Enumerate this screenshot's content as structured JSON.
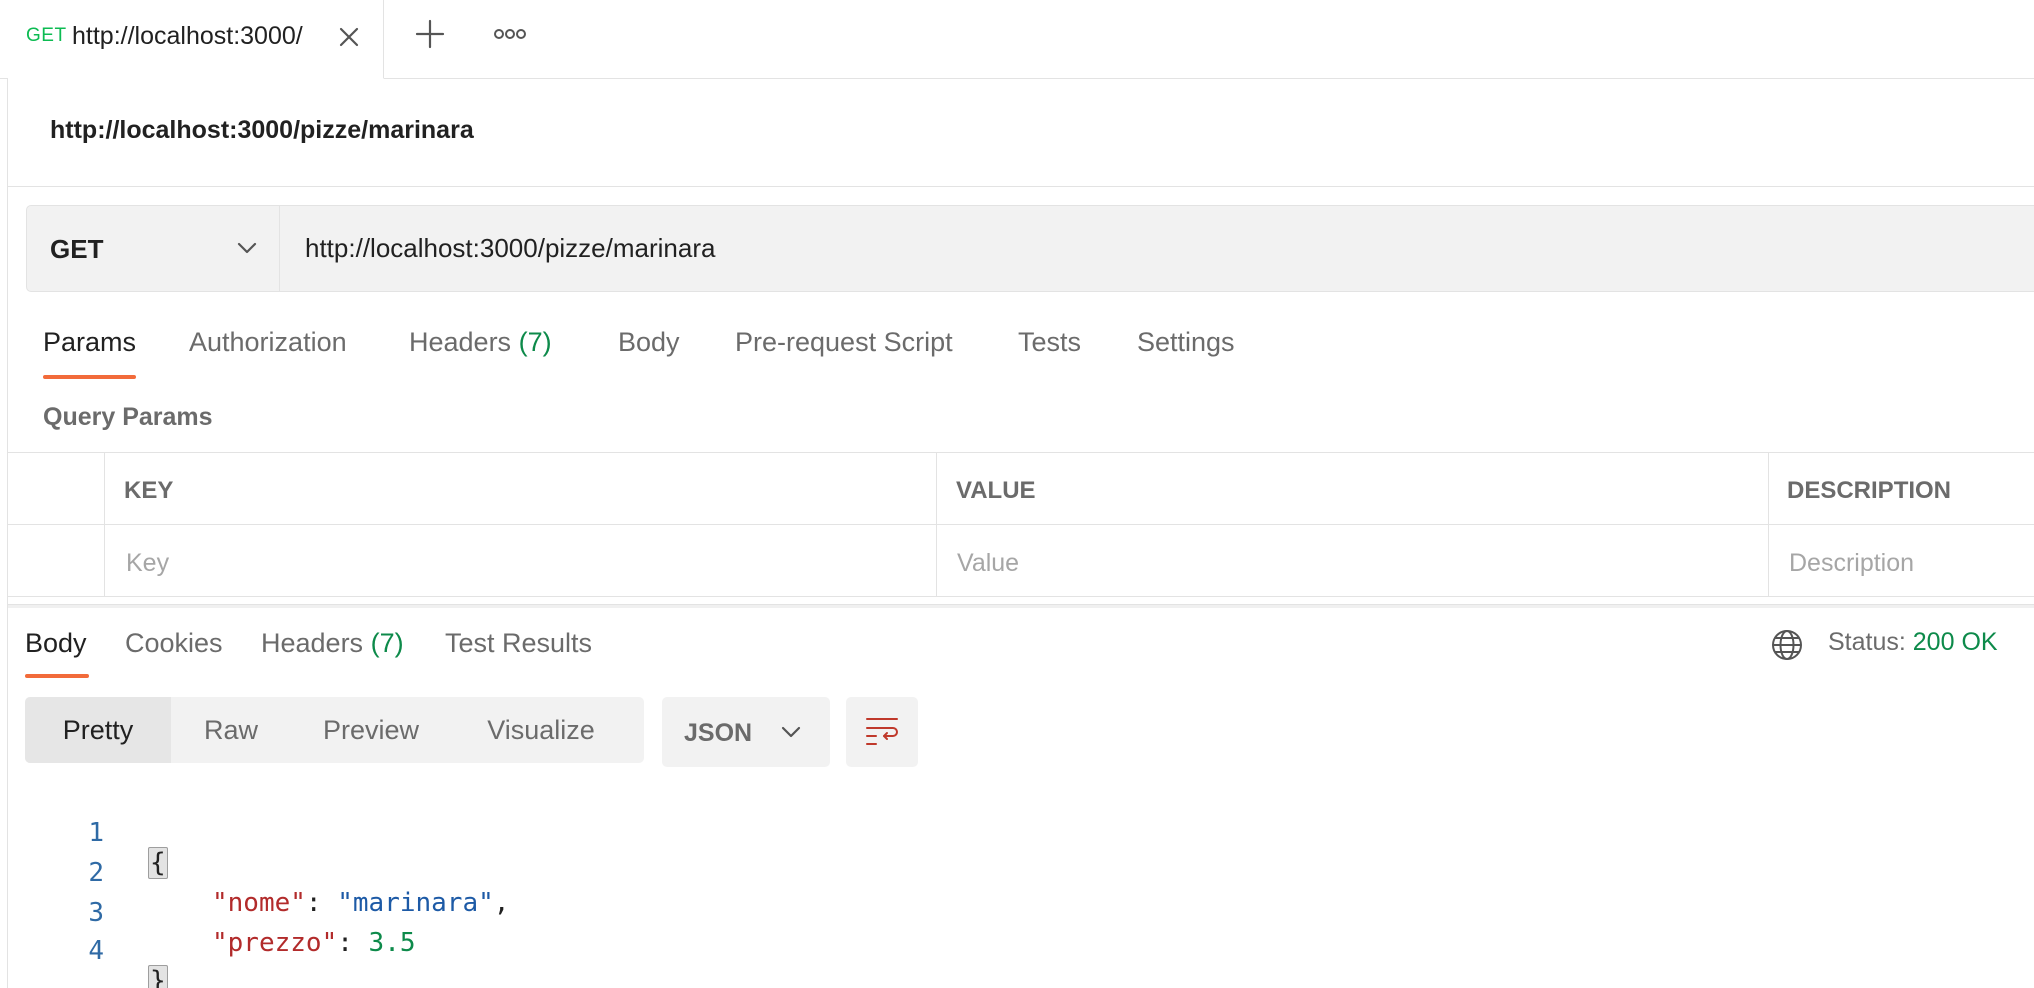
{
  "tab": {
    "method": "GET",
    "title": "http://localhost:3000/"
  },
  "request": {
    "name": "http://localhost:3000/pizze/marinara",
    "method": "GET",
    "url": "http://localhost:3000/pizze/marinara"
  },
  "request_tabs": {
    "params": "Params",
    "authorization": "Authorization",
    "headers": "Headers",
    "headers_count": "(7)",
    "body": "Body",
    "prerequest": "Pre-request Script",
    "tests": "Tests",
    "settings": "Settings"
  },
  "query_params": {
    "label": "Query Params",
    "columns": {
      "key": "KEY",
      "value": "VALUE",
      "description": "DESCRIPTION"
    },
    "placeholders": {
      "key": "Key",
      "value": "Value",
      "description": "Description"
    }
  },
  "response": {
    "tabs": {
      "body": "Body",
      "cookies": "Cookies",
      "headers": "Headers",
      "headers_count": "(7)",
      "test_results": "Test Results"
    },
    "status_label": "Status:",
    "status_value": "200 OK",
    "views": {
      "pretty": "Pretty",
      "raw": "Raw",
      "preview": "Preview",
      "visualize": "Visualize"
    },
    "format": "JSON",
    "code": {
      "line_numbers": [
        "1",
        "2",
        "3",
        "4"
      ],
      "open_brace": "{",
      "close_brace": "}",
      "key1": "\"nome\"",
      "val1": "\"marinara\"",
      "key2": "\"prezzo\"",
      "val2": "3.5",
      "colon": ": ",
      "comma": ","
    }
  },
  "colors": {
    "accent": "#f26b3a",
    "method_get": "#0cbb52",
    "status_ok": "#0d8a4a",
    "json_key": "#b22b2b",
    "json_string": "#1d5aa6",
    "json_number": "#0d8a4a"
  },
  "icons": [
    "close-icon",
    "plus-icon",
    "more-icon",
    "chevron-down-icon",
    "globe-icon",
    "wrap-lines-icon"
  ]
}
